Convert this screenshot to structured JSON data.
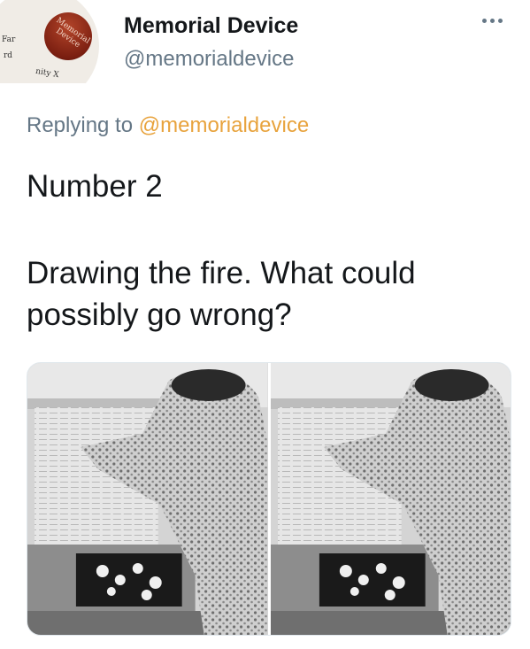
{
  "author": {
    "name": "Memorial Device",
    "handle": "@memorialdevice"
  },
  "avatar": {
    "badge_line1": "Memorial",
    "badge_line2": "Device",
    "background_fragments": [
      "Far",
      "rd",
      "nity X"
    ]
  },
  "reply": {
    "prefix": "Replying to",
    "handle": "@memorialdevice"
  },
  "tweet": {
    "line1": "Number 2",
    "line2": "Drawing the fire. What could",
    "line3": "possibly go wrong?"
  },
  "colors": {
    "accent": "#e8a33d",
    "muted": "#657786",
    "text": "#14171a"
  },
  "icons": {
    "more": "more-horizontal-icon"
  },
  "media": {
    "count": 2,
    "description_images": [
      "photo-left",
      "photo-right"
    ]
  }
}
